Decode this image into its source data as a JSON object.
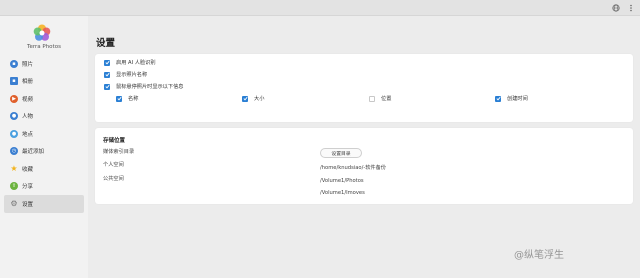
{
  "app": {
    "name": "Terra Photos"
  },
  "sidebar": {
    "items": [
      {
        "label": "照片",
        "icon": "photo-icon",
        "color": "#3b7fd1"
      },
      {
        "label": "相册",
        "icon": "album-icon",
        "color": "#3b7fd1"
      },
      {
        "label": "视频",
        "icon": "video-icon",
        "color": "#e0602c"
      },
      {
        "label": "人物",
        "icon": "person-icon",
        "color": "#3b7fd1"
      },
      {
        "label": "地点",
        "icon": "location-icon",
        "color": "#4aa0e0"
      },
      {
        "label": "最近添加",
        "icon": "recent-icon",
        "color": "#3b7fd1"
      },
      {
        "label": "收藏",
        "icon": "star-icon",
        "color": "#f2b31d"
      },
      {
        "label": "分享",
        "icon": "share-icon",
        "color": "#6cb33f"
      },
      {
        "label": "设置",
        "icon": "settings-icon",
        "color": "#777777"
      }
    ]
  },
  "main": {
    "title": "设置",
    "display_options": {
      "ai_recognition": "启用 AI 人脸识别",
      "show_name": "显示照片名称",
      "hover_info": "鼠标悬停照片时显示以下信息",
      "fields": {
        "name": "名称",
        "size": "大小",
        "location": "位置",
        "created": "创建时间"
      }
    },
    "storage": {
      "title": "存储位置",
      "media_index_label": "媒体索引目录",
      "set_dir_button": "设置目录",
      "personal_label": "个人空间",
      "personal_path": "/home/knudsiao/-软件备份",
      "public_label": "公共空间",
      "public_paths": [
        "/Volume1/Photos",
        "/Volume1/Imoves"
      ]
    }
  },
  "watermark": "@纵笔浮生"
}
